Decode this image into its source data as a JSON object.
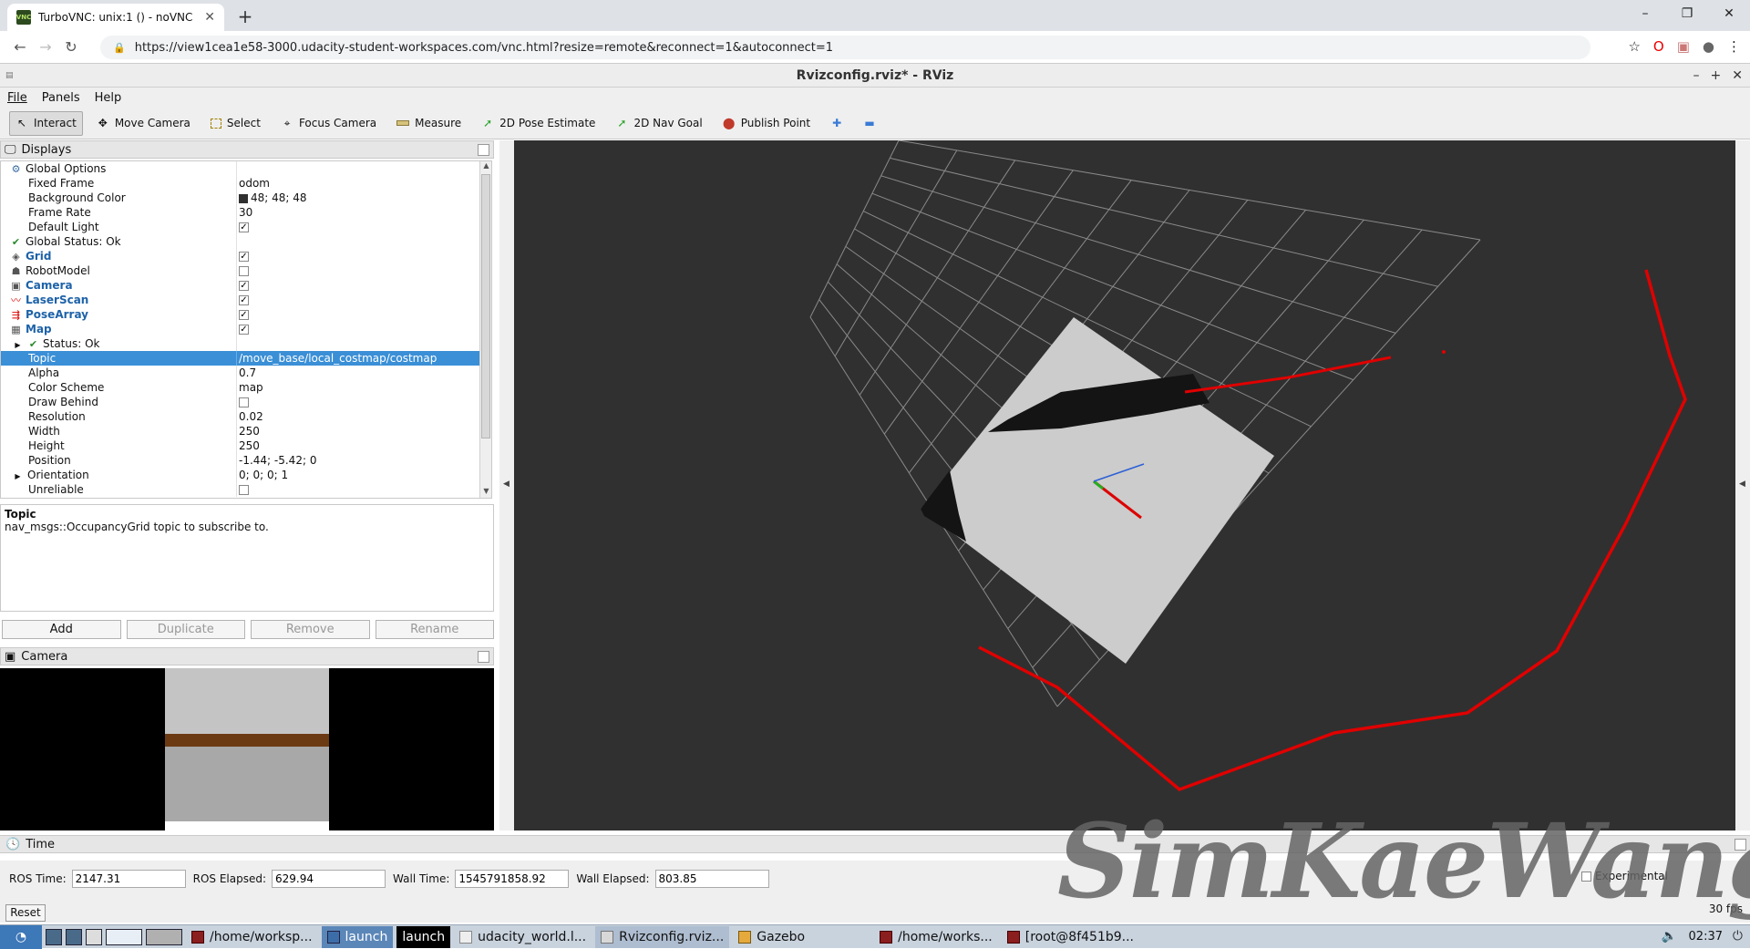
{
  "browser": {
    "tab_title": "TurboVNC: unix:1 () - noVNC",
    "favicon_text": "VNC",
    "url": "https://view1cea1e58-3000.udacity-student-workspaces.com/vnc.html?resize=remote&reconnect=1&autoconnect=1"
  },
  "window": {
    "title": "Rvizconfig.rviz* - RViz"
  },
  "menu": [
    "File",
    "Panels",
    "Help"
  ],
  "toolbar": {
    "interact": "Interact",
    "move_camera": "Move Camera",
    "select": "Select",
    "focus_camera": "Focus Camera",
    "measure": "Measure",
    "pose_estimate": "2D Pose Estimate",
    "nav_goal": "2D Nav Goal",
    "publish_point": "Publish Point"
  },
  "displays": {
    "header": "Displays",
    "rows": [
      {
        "label": "Global Options",
        "value": ""
      },
      {
        "label": "Fixed Frame",
        "value": "odom"
      },
      {
        "label": "Background Color",
        "value": "48; 48; 48"
      },
      {
        "label": "Frame Rate",
        "value": "30"
      },
      {
        "label": "Default Light",
        "value": ""
      },
      {
        "label": "Global Status: Ok",
        "value": ""
      },
      {
        "label": "Grid",
        "value": ""
      },
      {
        "label": "RobotModel",
        "value": ""
      },
      {
        "label": "Camera",
        "value": ""
      },
      {
        "label": "LaserScan",
        "value": ""
      },
      {
        "label": "PoseArray",
        "value": ""
      },
      {
        "label": "Map",
        "value": ""
      },
      {
        "label": "Status: Ok",
        "value": ""
      },
      {
        "label": "Topic",
        "value": "/move_base/local_costmap/costmap"
      },
      {
        "label": "Alpha",
        "value": "0.7"
      },
      {
        "label": "Color Scheme",
        "value": "map"
      },
      {
        "label": "Draw Behind",
        "value": ""
      },
      {
        "label": "Resolution",
        "value": "0.02"
      },
      {
        "label": "Width",
        "value": "250"
      },
      {
        "label": "Height",
        "value": "250"
      },
      {
        "label": "Position",
        "value": "-1.44; -5.42; 0"
      },
      {
        "label": "Orientation",
        "value": "0; 0; 0; 1"
      },
      {
        "label": "Unreliable",
        "value": ""
      }
    ]
  },
  "description": {
    "title": "Topic",
    "text": "nav_msgs::OccupancyGrid topic to subscribe to."
  },
  "buttons": {
    "add": "Add",
    "duplicate": "Duplicate",
    "remove": "Remove",
    "rename": "Rename"
  },
  "camera_panel": {
    "header": "Camera"
  },
  "time": {
    "header": "Time",
    "ros_time_label": "ROS Time:",
    "ros_time": "2147.31",
    "ros_elapsed_label": "ROS Elapsed:",
    "ros_elapsed": "629.94",
    "wall_time_label": "Wall Time:",
    "wall_time": "1545791858.92",
    "wall_elapsed_label": "Wall Elapsed:",
    "wall_elapsed": "803.85",
    "experimental": "Experimental",
    "reset": "Reset",
    "fps": "30 fps"
  },
  "watermark": "SimKaeWang",
  "taskbar": {
    "items": [
      "/home/worksp...",
      "launch",
      "launch",
      "udacity_world.l...",
      "Rvizconfig.rviz...",
      "Gazebo",
      "/home/works...",
      "[root@8f451b9..."
    ],
    "clock": "02:37"
  },
  "colors": {
    "viewport_bg": "#303030",
    "selection": "#3a8fd6",
    "laser": "#e00000",
    "map_free": "#cccccc",
    "map_occupied": "#141414"
  }
}
